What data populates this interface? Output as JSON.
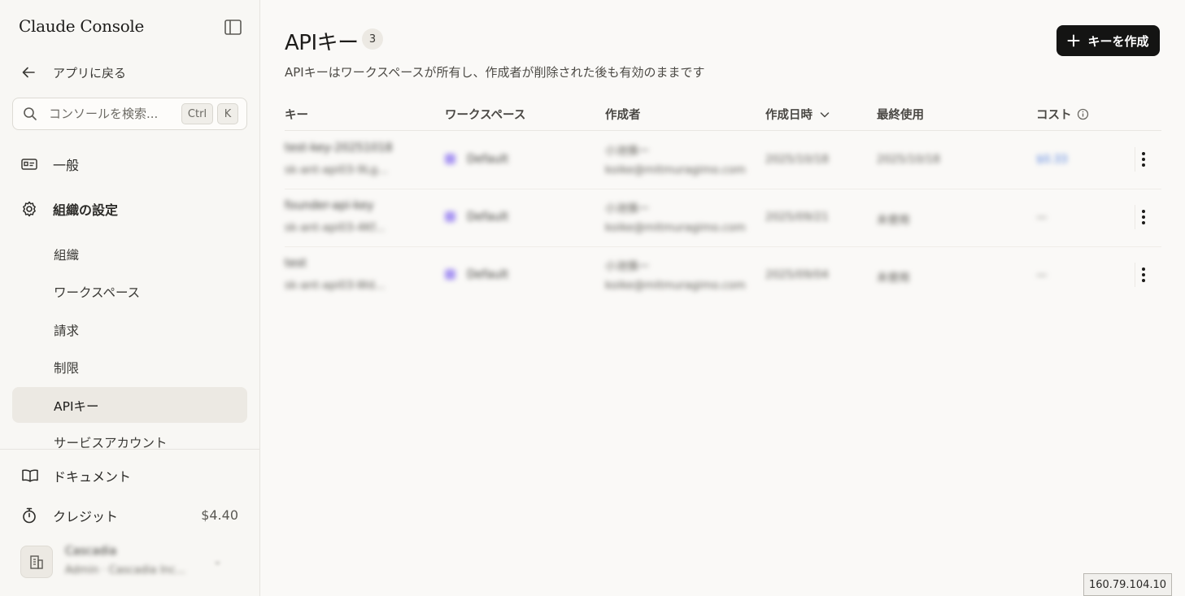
{
  "sidebar": {
    "brand": "Claude Console",
    "back_label": "アプリに戻る",
    "search": {
      "placeholder": "コンソールを検索...",
      "shortcut_ctrl": "Ctrl",
      "shortcut_key": "K"
    },
    "nav": {
      "general": "一般",
      "org_settings": "組織の設定",
      "sub_items": [
        "組織",
        "ワークスペース",
        "請求",
        "制限",
        "APIキー",
        "サービスアカウント"
      ],
      "active_item": "APIキー"
    },
    "bottom": {
      "docs": "ドキュメント",
      "credits": "クレジット",
      "credits_amount": "$4.40",
      "org_name": "Cascadia",
      "org_sub": "Admin · Cascadia Inc..."
    }
  },
  "main": {
    "title": "APIキー",
    "count": "3",
    "subtitle": "APIキーはワークスペースが所有し、作成者が削除された後も有効のままです",
    "create_button": "キーを作成",
    "columns": {
      "key": "キー",
      "workspace": "ワークスペース",
      "creator": "作成者",
      "created_at": "作成日時",
      "last_used": "最終使用",
      "cost": "コスト"
    },
    "rows": [
      {
        "name": "test-key-20251018",
        "key_id": "sk-ant-api03-9Lg...",
        "workspace": "Default",
        "creator_name": "小池慎一",
        "creator_email": "koike@mitmuragimo.com",
        "created_at": "2025/10/18",
        "last_used": "2025/10/18",
        "cost": "$0.33"
      },
      {
        "name": "founder-api-key",
        "key_id": "sk-ant-api03-4Kf...",
        "workspace": "Default",
        "creator_name": "小池慎一",
        "creator_email": "koike@mitmuragimo.com",
        "created_at": "2025/09/21",
        "last_used": "未使用",
        "cost": "—"
      },
      {
        "name": "test",
        "key_id": "sk-ant-api03-Wd...",
        "workspace": "Default",
        "creator_name": "小池慎一",
        "creator_email": "koike@mitmuragimo.com",
        "created_at": "2025/09/04",
        "last_used": "未使用",
        "cost": "—"
      }
    ]
  },
  "ip_tag": "160.79.104.10"
}
